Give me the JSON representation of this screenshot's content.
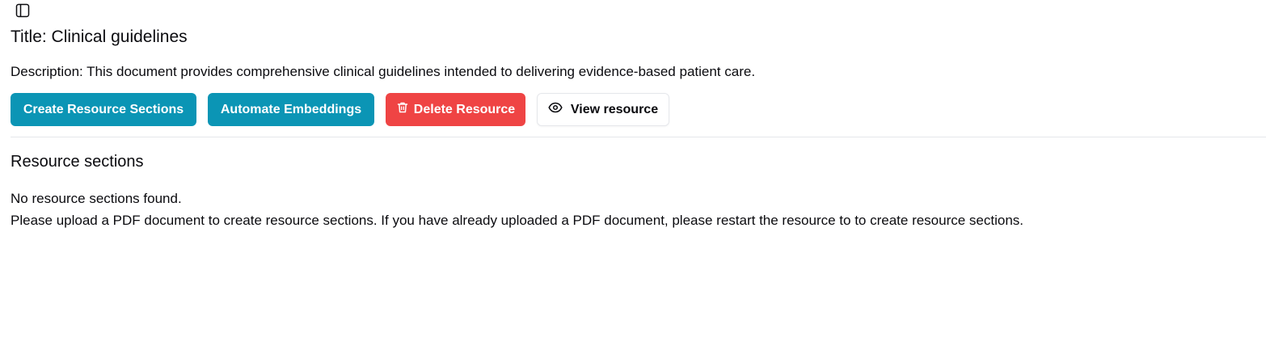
{
  "header": {
    "toggle_icon": "sidebar-panel-icon",
    "title": "Title: Clinical guidelines",
    "description": "Description: This document provides comprehensive clinical guidelines intended to delivering evidence-based patient care."
  },
  "actions": {
    "create_sections": "Create Resource Sections",
    "automate_embeddings": "Automate Embeddings",
    "delete_resource": "Delete Resource",
    "view_resource": "View resource",
    "delete_icon": "trash-icon",
    "view_icon": "eye-icon"
  },
  "sections": {
    "heading": "Resource sections",
    "empty_title": "No resource sections found.",
    "empty_hint": "Please upload a PDF document to create resource sections. If you have already uploaded a PDF document, please restart the resource to to create resource sections."
  },
  "colors": {
    "primary": "#0b95b5",
    "danger": "#ef4444",
    "border": "#e5e7eb",
    "text": "#0b0b0f"
  }
}
